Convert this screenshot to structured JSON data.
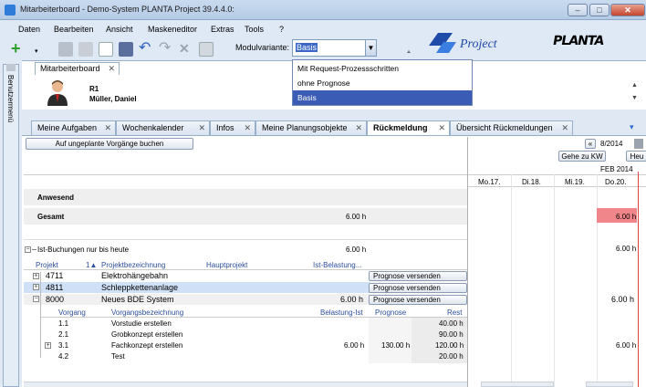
{
  "window": {
    "title": "Mitarbeiterboard - Demo-System   PLANTA Project 39.4.4.0:"
  },
  "menu": [
    "Daten",
    "Bearbeiten",
    "Ansicht",
    "Maskeneditor",
    "Extras",
    "Tools",
    "?"
  ],
  "toolbar": {
    "modul_label": "Modulvariante:",
    "modul_value": "Basis",
    "modul_options": [
      "Mit Request-Prozessschritten",
      "ohne Prognose",
      "Basis"
    ]
  },
  "logos": {
    "project": "Project",
    "planta": "PLANTA"
  },
  "side_tab": "Benutzermenü",
  "module_tab": "Mitarbeiterboard",
  "user": {
    "code": "R1",
    "name": "Müller, Daniel"
  },
  "tabs": [
    "Meine Aufgaben",
    "Wochenkalender",
    "Infos",
    "Meine Planungsobjekte",
    "Rückmeldung",
    "Übersicht Rückmeldungen"
  ],
  "active_tab": "Rückmeldung",
  "buttons": {
    "ungeplant": "Auf ungeplante Vorgänge buchen",
    "gehe_zu_kw": "Gehe zu KW",
    "heute": "Heu",
    "prognose": "Prognose versenden"
  },
  "calendar": {
    "week": "8/2014",
    "month": "FEB 2014",
    "days": [
      "Mo.17.",
      "Di.18.",
      "Mi.19.",
      "Do.20."
    ]
  },
  "summary": {
    "anwesend": "Anwesend",
    "gesamt_label": "Gesamt",
    "gesamt_value": "6.00 h",
    "gesamt_day": "6.00 h",
    "ist_label": "Ist-Buchungen nur bis heute",
    "ist_value": "6.00 h",
    "ist_day": "6.00 h"
  },
  "project_columns": [
    "Projekt",
    "1▲",
    "Projektbezeichnung",
    "Hauptprojekt",
    "Ist-Belastung..."
  ],
  "projects": [
    {
      "id": "4711",
      "name": "Elektrohängebahn",
      "ist": "",
      "day": ""
    },
    {
      "id": "4811",
      "name": "Schleppkettenanlage",
      "ist": "",
      "day": ""
    },
    {
      "id": "8000",
      "name": "Neues BDE System",
      "ist": "6.00 h",
      "day": "6.00 h"
    }
  ],
  "task_columns": [
    "Vorgang",
    "Vorgangsbezeichnung",
    "Belastung-Ist",
    "Prognose",
    "Rest"
  ],
  "tasks": [
    {
      "id": "1.1",
      "name": "Vorstudie erstellen",
      "ist": "",
      "prognose": "",
      "rest": "40.00 h",
      "day": ""
    },
    {
      "id": "2.1",
      "name": "Grobkonzept erstellen",
      "ist": "",
      "prognose": "",
      "rest": "90.00 h",
      "day": ""
    },
    {
      "id": "3.1",
      "name": "Fachkonzept erstellen",
      "ist": "6.00 h",
      "prognose": "130.00 h",
      "rest": "120.00 h",
      "day": "6.00 h"
    },
    {
      "id": "4.2",
      "name": "Test",
      "ist": "",
      "prognose": "",
      "rest": "20.00 h",
      "day": ""
    }
  ]
}
